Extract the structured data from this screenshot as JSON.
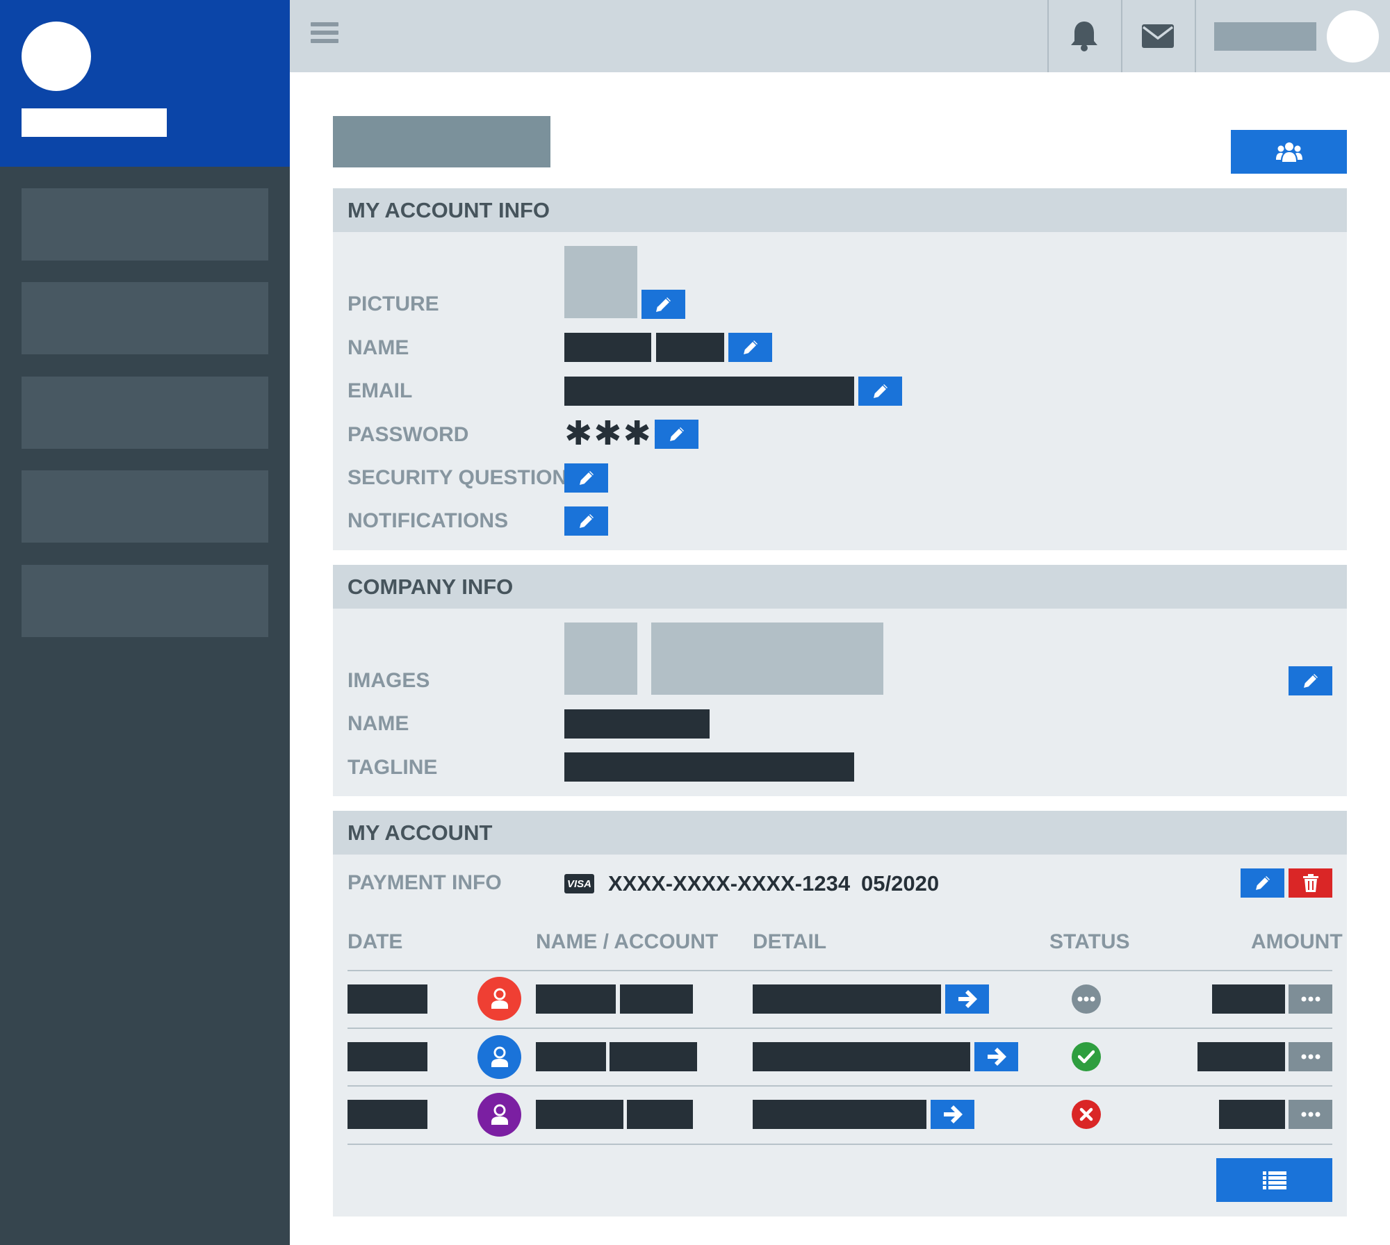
{
  "sidebar": {
    "brand_logo": "brand-logo",
    "brand_name": "brand-name",
    "items": [
      "nav-item-1",
      "nav-item-2",
      "nav-item-3",
      "nav-item-4",
      "nav-item-5"
    ]
  },
  "topbar": {
    "icons": [
      "menu-icon",
      "bell-icon",
      "envelope-icon"
    ],
    "user_avatar": "user-avatar"
  },
  "page": {
    "team_icon": "users-icon"
  },
  "account_info": {
    "title": "MY ACCOUNT INFO",
    "labels": {
      "picture": "PICTURE",
      "name": "NAME",
      "email": "EMAIL",
      "password": "PASSWORD",
      "security_questions": "SECURITY QUESTIONS",
      "notifications": "NOTIFICATIONS"
    },
    "password_mask": "✱✱✱✱"
  },
  "company_info": {
    "title": "COMPANY INFO",
    "labels": {
      "images": "IMAGES",
      "name": "NAME",
      "tagline": "TAGLINE"
    }
  },
  "my_account": {
    "title": "MY ACCOUNT",
    "payment_label": "PAYMENT INFO",
    "card_brand": "VISA",
    "card_number": "XXXX-XXXX-XXXX-1234",
    "card_expiry": "05/2020",
    "columns": {
      "date": "DATE",
      "name_account": "NAME / ACCOUNT",
      "detail": "DETAIL",
      "status": "STATUS",
      "amount": "AMOUNT"
    },
    "rows": [
      {
        "avatar_color": "#ef3f33",
        "status": "pending",
        "status_color": "#7e8e97"
      },
      {
        "avatar_color": "#1a73d9",
        "status": "approved",
        "status_color": "#2e9e3f"
      },
      {
        "avatar_color": "#7b1fa2",
        "status": "declined",
        "status_color": "#da2626"
      }
    ]
  },
  "colors": {
    "brand": "#0b45a8",
    "sidebar": "#36454e",
    "accent": "#1a73d9",
    "danger": "#da2626",
    "success": "#2e9e3f"
  }
}
